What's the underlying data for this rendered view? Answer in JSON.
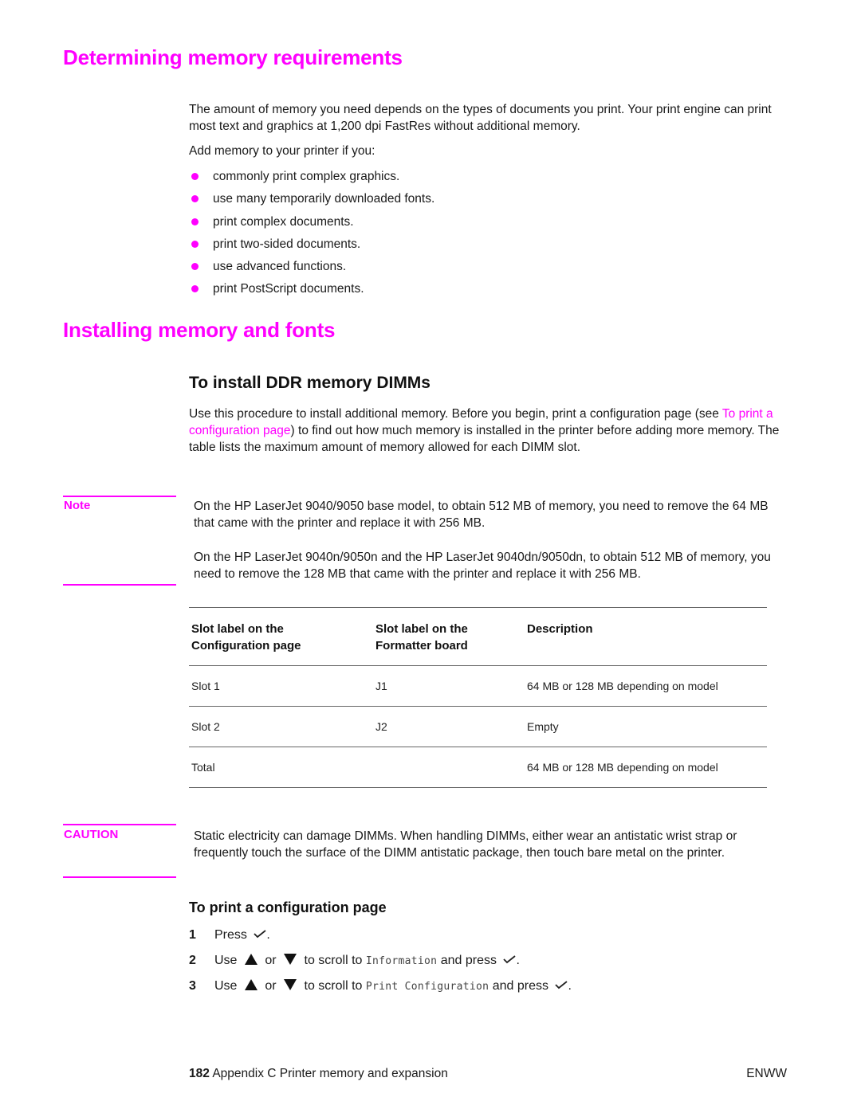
{
  "section1": {
    "title": "Determining memory requirements",
    "intro": "The amount of memory you need depends on the types of documents you print. Your print engine can print most text and graphics at 1,200 dpi FastRes without additional memory.",
    "lead": "Add memory to your printer if you:",
    "bullets": [
      "commonly print complex graphics.",
      "use many temporarily downloaded fonts.",
      "print complex documents.",
      "print two-sided documents.",
      "use advanced functions.",
      "print PostScript documents."
    ]
  },
  "section2": {
    "title": "Installing memory and fonts",
    "subsection": {
      "title": "To install DDR memory DIMMs",
      "para_before_link": "Use this procedure to install additional memory. Before you begin, print a configuration page (see ",
      "link_text": "To print a configuration page",
      "para_after_link": ") to find out how much memory is installed in the printer before adding more memory. The table lists the maximum amount of memory allowed for each DIMM slot."
    },
    "note": {
      "label": "Note",
      "paragraphs": [
        "On the HP LaserJet 9040/9050 base model, to obtain 512 MB of memory, you need to remove the 64 MB that came with the printer and replace it with 256 MB.",
        "On the HP LaserJet 9040n/9050n and the HP LaserJet 9040dn/9050dn, to obtain 512 MB of memory, you need to remove the 128 MB that came with the printer and replace it with 256 MB."
      ]
    },
    "table": {
      "headers": [
        [
          "Slot label on the",
          "Configuration page"
        ],
        [
          "Slot label on the",
          "Formatter board"
        ],
        [
          "Description",
          ""
        ]
      ],
      "rows": [
        [
          "Slot 1",
          "J1",
          "64 MB or 128 MB depending on model"
        ],
        [
          "Slot 2",
          "J2",
          "Empty"
        ],
        [
          "Total",
          "",
          "64 MB or 128 MB depending on model"
        ]
      ]
    },
    "caution": {
      "label": "CAUTION",
      "text": "Static electricity can damage DIMMs. When handling DIMMs, either wear an antistatic wrist strap or frequently touch the surface of the DIMM antistatic package, then touch bare metal on the printer."
    }
  },
  "section3": {
    "title": "To print a configuration page",
    "steps": [
      {
        "num": "1",
        "text_before": "Press",
        "menu_item": "",
        "text_after": ""
      },
      {
        "num": "2",
        "text_before": "Use",
        "or": "or",
        "scroll": "to scroll to",
        "menu_item": "Information",
        "text_after": "and press"
      },
      {
        "num": "3",
        "text_before": "Use",
        "or": "or",
        "scroll": "to scroll to",
        "menu_item": "Print Configuration",
        "text_after": "and press"
      }
    ],
    "icons": {
      "select": "checkmark-icon",
      "up": "up-arrow-icon",
      "down": "down-arrow-icon"
    }
  },
  "footer": {
    "page_number": "182",
    "chapter": "Appendix C Printer memory and expansion",
    "right": "ENWW"
  },
  "colors": {
    "accent": "#ff00ff",
    "text": "#1a1a1a",
    "rule": "#666666"
  }
}
